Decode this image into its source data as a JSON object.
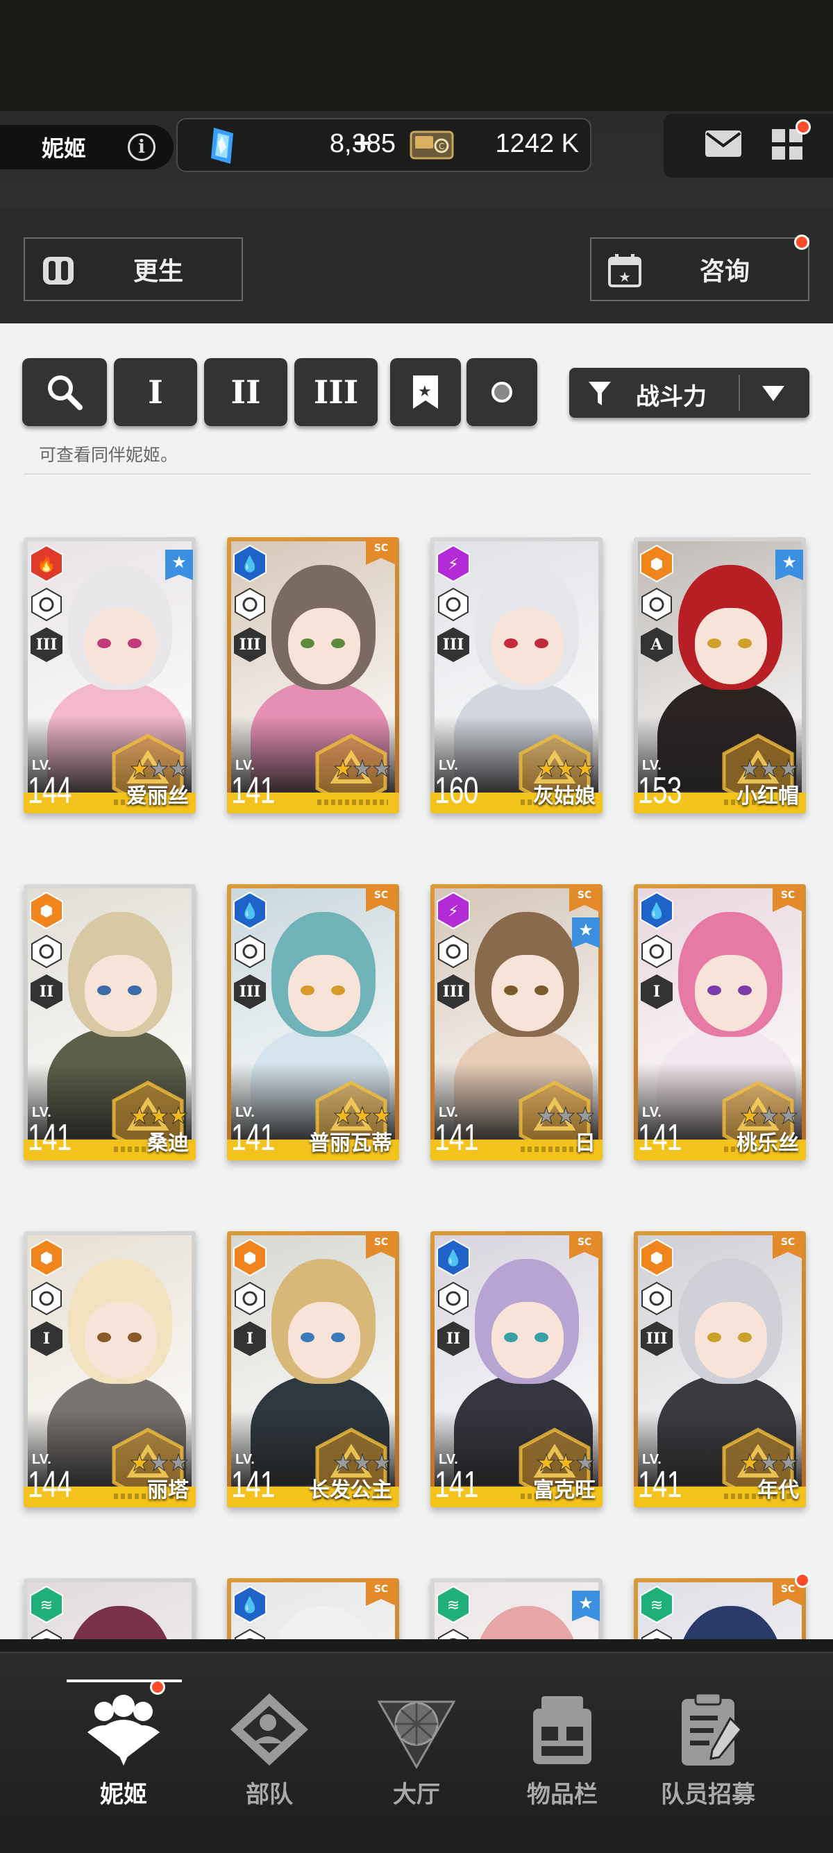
{
  "header": {
    "player_name": "妮姬",
    "gems": "8,385",
    "gems_plus": "+",
    "credits": "1242 K"
  },
  "actions": {
    "rebirth_label": "更生",
    "consult_label": "咨询"
  },
  "filters": {
    "tier1": "I",
    "tier2": "II",
    "tier3": "III",
    "sort_label": "战斗力"
  },
  "hint": "可查看同伴妮姬。",
  "characters": [
    {
      "name": "爱丽丝",
      "level": "144",
      "element": "fire",
      "rank": "III",
      "rarity": "r",
      "stars": 1,
      "favorite": true
    },
    {
      "name": "",
      "level": "141",
      "element": "water",
      "rank": "III",
      "rarity": "sr",
      "stars": 1,
      "favorite": false
    },
    {
      "name": "灰姑娘",
      "level": "160",
      "element": "electric",
      "rank": "III",
      "rarity": "r",
      "stars": 3,
      "favorite": false
    },
    {
      "name": "小红帽",
      "level": "153",
      "element": "iron",
      "rank": "A",
      "rarity": "r",
      "stars": 0,
      "favorite": true
    },
    {
      "name": "桑迪",
      "level": "141",
      "element": "iron",
      "rank": "II",
      "rarity": "r",
      "stars": 3,
      "favorite": false
    },
    {
      "name": "普丽瓦蒂",
      "level": "141",
      "element": "water",
      "rank": "III",
      "rarity": "sr",
      "stars": 3,
      "favorite": false
    },
    {
      "name": "日",
      "level": "141",
      "element": "electric",
      "rank": "III",
      "rarity": "sr",
      "stars": 0,
      "favorite": true
    },
    {
      "name": "桃乐丝",
      "level": "141",
      "element": "water",
      "rank": "I",
      "rarity": "sr",
      "stars": 1,
      "favorite": false
    },
    {
      "name": "丽塔",
      "level": "144",
      "element": "iron",
      "rank": "I",
      "rarity": "r",
      "stars": 1,
      "favorite": false
    },
    {
      "name": "长发公主",
      "level": "141",
      "element": "iron",
      "rank": "I",
      "rarity": "sr",
      "stars": 0,
      "favorite": false
    },
    {
      "name": "富克旺",
      "level": "141",
      "element": "water",
      "rank": "II",
      "rarity": "sr",
      "stars": 2,
      "favorite": false
    },
    {
      "name": "年代",
      "level": "141",
      "element": "iron",
      "rank": "III",
      "rarity": "sr",
      "stars": 1,
      "favorite": false
    },
    {
      "name": "",
      "level": "",
      "element": "wind",
      "rank": "",
      "rarity": "r",
      "stars": 0,
      "favorite": false
    },
    {
      "name": "",
      "level": "",
      "element": "water",
      "rank": "",
      "rarity": "sr",
      "stars": 0,
      "favorite": false
    },
    {
      "name": "",
      "level": "",
      "element": "wind",
      "rank": "",
      "rarity": "r",
      "stars": 0,
      "favorite": true
    },
    {
      "name": "",
      "level": "",
      "element": "wind",
      "rank": "",
      "rarity": "sr",
      "stars": 0,
      "favorite": false
    }
  ],
  "nav": {
    "nikke": "妮姬",
    "squad": "部队",
    "lobby": "大厅",
    "inventory": "物品栏",
    "recruit": "队员招募"
  },
  "colors": {
    "sr_frame": "#d99a3b",
    "r_frame": "#cfcfcf",
    "level_strip": "#f4c21c",
    "fire": "#e03b2a",
    "water": "#1f63c8",
    "electric": "#b32bd6",
    "iron": "#f0851e",
    "wind": "#1fb07a",
    "notification": "#ff4b2b"
  }
}
